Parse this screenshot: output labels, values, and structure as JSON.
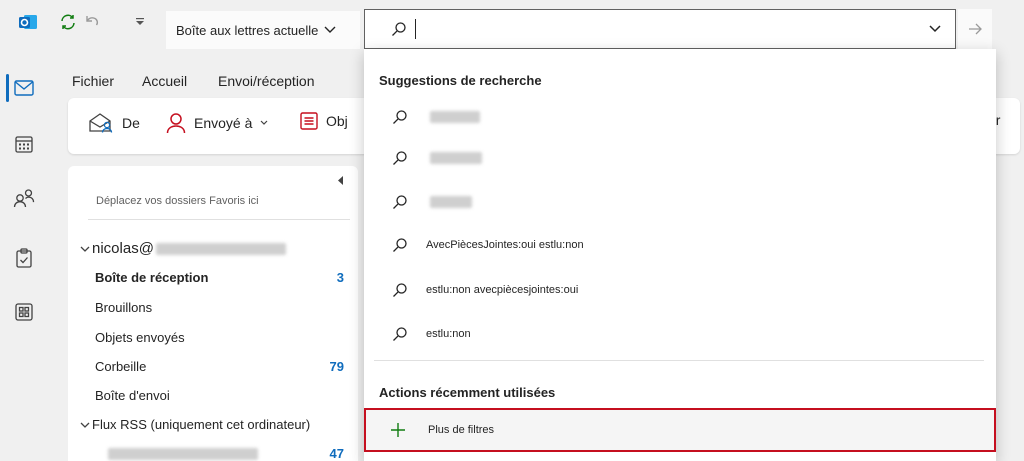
{
  "titlebar": {
    "mailbox_label": "Boîte aux lettres actuelle",
    "search_value": ""
  },
  "menu": {
    "items": [
      "Fichier",
      "Accueil",
      "Envoi/réception"
    ]
  },
  "ribbon": {
    "from_label": "De",
    "sent_to_label": "Envoyé à",
    "subject_label": "Obj",
    "right_partial": "ur"
  },
  "folders": {
    "favorites_hint": "Déplacez vos dossiers Favoris ici",
    "account_prefix": "nicolas@",
    "items": [
      {
        "label": "Boîte de réception",
        "count": "3"
      },
      {
        "label": "Brouillons",
        "count": ""
      },
      {
        "label": "Objets envoyés",
        "count": ""
      },
      {
        "label": "Corbeille",
        "count": "79"
      },
      {
        "label": "Boîte d'envoi",
        "count": ""
      }
    ],
    "rss_label": "Flux RSS (uniquement cet ordinateur)",
    "rss_count": "47"
  },
  "dropdown": {
    "suggestions_heading": "Suggestions de recherche",
    "suggestions": [
      "AvecPiècesJointes:oui estlu:non",
      "estlu:non avecpiècesjointes:oui",
      "estlu:non"
    ],
    "recent_heading": "Actions récemment utilisées",
    "more_filters_label": "Plus de filtres"
  },
  "colors": {
    "accent": "#0f6cbd",
    "highlight": "#c50f1f",
    "plus": "#107c10"
  }
}
